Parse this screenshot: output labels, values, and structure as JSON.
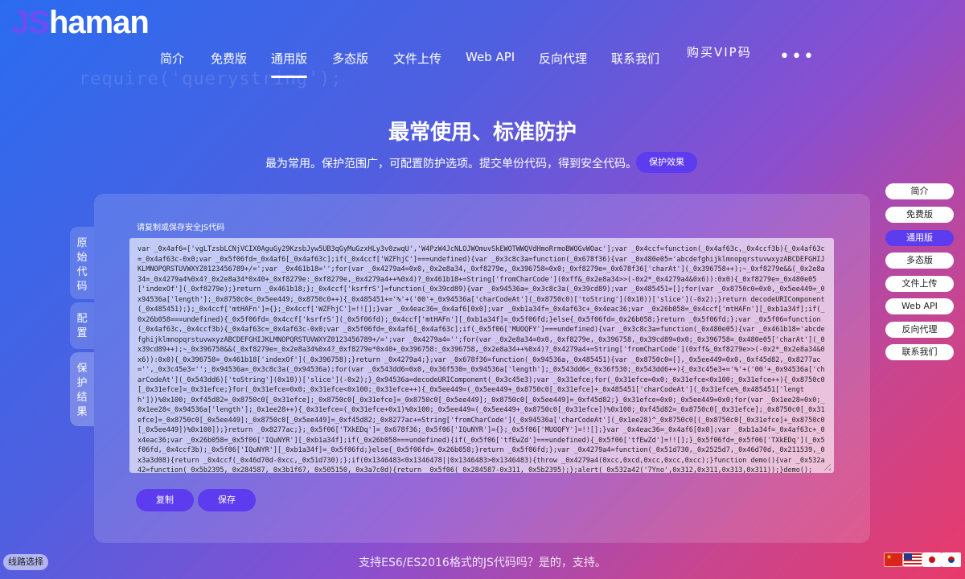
{
  "brand": {
    "logo_prefix": "JS",
    "logo_rest": "haman"
  },
  "background_code": "require('querystring');",
  "nav": {
    "items": [
      "简介",
      "免费版",
      "通用版",
      "多态版",
      "文件上传",
      "Web API",
      "反向代理",
      "联系我们",
      "购买VIP码"
    ],
    "active": "通用版",
    "more": "•••"
  },
  "hero": {
    "title": "最常使用、标准防护",
    "subtitle": "最为常用。保护范围广，可配置防护选项。提交单份代码，得到安全代码。",
    "effect_button": "保护效果"
  },
  "side_tabs": [
    "原始代码",
    "配置",
    "保护结果"
  ],
  "result": {
    "label": "请复制或保存安全JS代码",
    "code": "var _0x4af6=['vgLTzsbLCNjVCIX0AguGy29KzsbJyw5UB3qGyMuGzxHLy3v0zwqU','W4PzW4JcNLOJWOmuvSkEWOTWWQVdHmoRrmoBWOGvWOac'];var _0x4ccf=function(_0x4af63c,_0x4ccf3b){_0x4af63c=_0x4af63c-0x0;var _0x5f06fd=_0x4af6[_0x4af63c];if(_0x4ccf['WZFhjC']===undefined){var _0x3c8c3a=function(_0x678f36){var _0x480e05='abcdefghijklmnopqrstuvwxyzABCDEFGHIJKLMNOPQRSTUVWXYZ0123456789+/=';var _0x461b18='';for(var _0x4279a4=0x0,_0x2e8a34,_0xf8279e,_0x396758=0x0;_0xf8279e=_0x678f36['charAt'](_0x396758++);~_0xf8279e&&(_0x2e8a34=_0x4279a4%0x4?_0x2e8a34*0x40+_0xf8279e:_0xf8279e,_0x4279a4++%0x4)?_0x461b18+=String['fromCharCode'](0xff&_0x2e8a34>>(-0x2*_0x4279a4&0x6)):0x0){_0xf8279e=_0x480e05['indexOf'](_0xf8279e);}return _0x461b18;};_0x4ccf['ksrfrS']=function(_0x39cd89){var _0x94536a=_0x3c8c3a(_0x39cd89);var _0x485451=[];for(var _0x8750c0=0x0,_0x5ee449=_0x94536a['length'];_0x8750c0<_0x5ee449;_0x8750c0++){_0x485451+='%'+('00'+_0x94536a['charCodeAt'](_0x8750c0)['toString'](0x10))['slice'](-0x2);}return decodeURIComponent(_0x485451);};_0x4ccf['mtHAFn']={};_0x4ccf['WZFhjC']=!![];}var _0x4eac36=_0x4af6[0x0];var _0xb1a34f=_0x4af63c+_0x4eac36;var _0x26b058=_0x4ccf['mtHAFn'][_0xb1a34f];if(_0x26b058===undefined){_0x5f06fd=_0x4ccf['ksrfrS'](_0x5f06fd);_0x4ccf['mtHAFn'][_0xb1a34f]=_0x5f06fd;}else{_0x5f06fd=_0x26b058;}return _0x5f06fd;};var _0x5f06=function(_0x4af63c,_0x4ccf3b){_0x4af63c=_0x4af63c-0x0;var _0x5f06fd=_0x4af6[_0x4af63c];if(_0x5f06['MUOQFY']===undefined){var _0x3c8c3a=function(_0x480e05){var _0x461b18='abcdefghijklmnopqrstuvwxyzABCDEFGHIJKLMNOPQRSTUVWXYZ0123456789+/=';var _0x4279a4='';for(var _0x2e8a34=0x0,_0xf8279e,_0x396758,_0x39cd89=0x0;_0x396758=_0x480e05['charAt'](_0x39cd89++);~_0x396758&&(_0xf8279e=_0x2e8a34%0x4?_0xf8279e*0x40+_0x396758:_0x396758,_0x2e8a34++%0x4)?_0x4279a4+=String['fromCharCode'](0xff&_0xf8279e>>(-0x2*_0x2e8a34&0x6)):0x0){_0x396758=_0x461b18['indexOf'](_0x396758);}return _0x4279a4;};var _0x678f36=function(_0x94536a,_0x485451){var _0x8750c0=[],_0x5ee449=0x0,_0xf45d82,_0x8277ac='',_0x3c45e3='';_0x94536a=_0x3c8c3a(_0x94536a);for(var _0x543dd6=0x0,_0x36f530=_0x94536a['length'];_0x543dd6<_0x36f530;_0x543dd6++){_0x3c45e3+='%'+('00'+_0x94536a['charCodeAt'](_0x543dd6)['toString'](0x10))['slice'](-0x2);}_0x94536a=decodeURIComponent(_0x3c45e3);var _0x31efce;for(_0x31efce=0x0;_0x31efce<0x100;_0x31efce++){_0x8750c0[_0x31efce]=_0x31efce;}for(_0x31efce=0x0;_0x31efce<0x100;_0x31efce++){_0x5ee449=(_0x5ee449+_0x8750c0[_0x31efce]+_0x485451['charCodeAt'](_0x31efce%_0x485451['length']))%0x100;_0xf45d82=_0x8750c0[_0x31efce];_0x8750c0[_0x31efce]=_0x8750c0[_0x5ee449];_0x8750c0[_0x5ee449]=_0xf45d82;}_0x31efce=0x0;_0x5ee449=0x0;for(var _0x1ee28=0x0;_0x1ee28<_0x94536a['length'];_0x1ee28++){_0x31efce=(_0x31efce+0x1)%0x100;_0x5ee449=(_0x5ee449+_0x8750c0[_0x31efce])%0x100;_0xf45d82=_0x8750c0[_0x31efce];_0x8750c0[_0x31efce]=_0x8750c0[_0x5ee449];_0x8750c0[_0x5ee449]=_0xf45d82;_0x8277ac+=String['fromCharCode'](_0x94536a['charCodeAt'](_0x1ee28)^_0x8750c0[(_0x8750c0[_0x31efce]+_0x8750c0[_0x5ee449])%0x100]);}return _0x8277ac;};_0x5f06['TXkEDq']=_0x678f36;_0x5f06['IQuNYR']={};_0x5f06['MUOQFY']=!![];}var _0x4eac36=_0x4af6[0x0];var _0xb1a34f=_0x4af63c+_0x4eac36;var _0x26b058=_0x5f06['IQuNYR'][_0xb1a34f];if(_0x26b058===undefined){if(_0x5f06['tfEwZd']===undefined){_0x5f06['tfEwZd']=!![];}_0x5f06fd=_0x5f06['TXkEDq'](_0x5f06fd,_0x4ccf3b);_0x5f06['IQuNYR'][_0xb1a34f]=_0x5f06fd;}else{_0x5f06fd=_0x26b058;}return _0x5f06fd;};var _0x4279a4=function(_0x51d730,_0x2525d7,_0x46d70d,_0x211539,_0x3a3d08){return _0x4ccf(_0x46d70d-0xcc,_0x51d730);};if(0x1346483<0x1346478||0x1346483>0x1346483){throw _0x4279a4(0xcc,0xcd,0xcc,0xcc,0xcc);}function demo(){var _0x532a42=function(_0x5b2395,_0x284587,_0x3b1f67,_0x505150,_0x3a7c0d){return _0x5f06(_0x284587-0x311,_0x5b2395);};alert(_0x532a42('7Yno',0x312,0x311,0x313,0x311));}demo();",
    "copy_button": "复制",
    "save_button": "保存"
  },
  "right_menu": {
    "items": [
      "简介",
      "免费版",
      "通用版",
      "多态版",
      "文件上传",
      "Web API",
      "反向代理",
      "联系我们"
    ],
    "active": "通用版"
  },
  "footer": {
    "text": "支持ES6/ES2016格式的JS代码吗？是的，支持。",
    "route_button": "线路选择"
  },
  "languages": [
    "flag-cn-icon",
    "flag-us-icon",
    "flag-jp-icon",
    "flag-kr-icon"
  ],
  "colors": {
    "accent": "#5d3cf0"
  }
}
